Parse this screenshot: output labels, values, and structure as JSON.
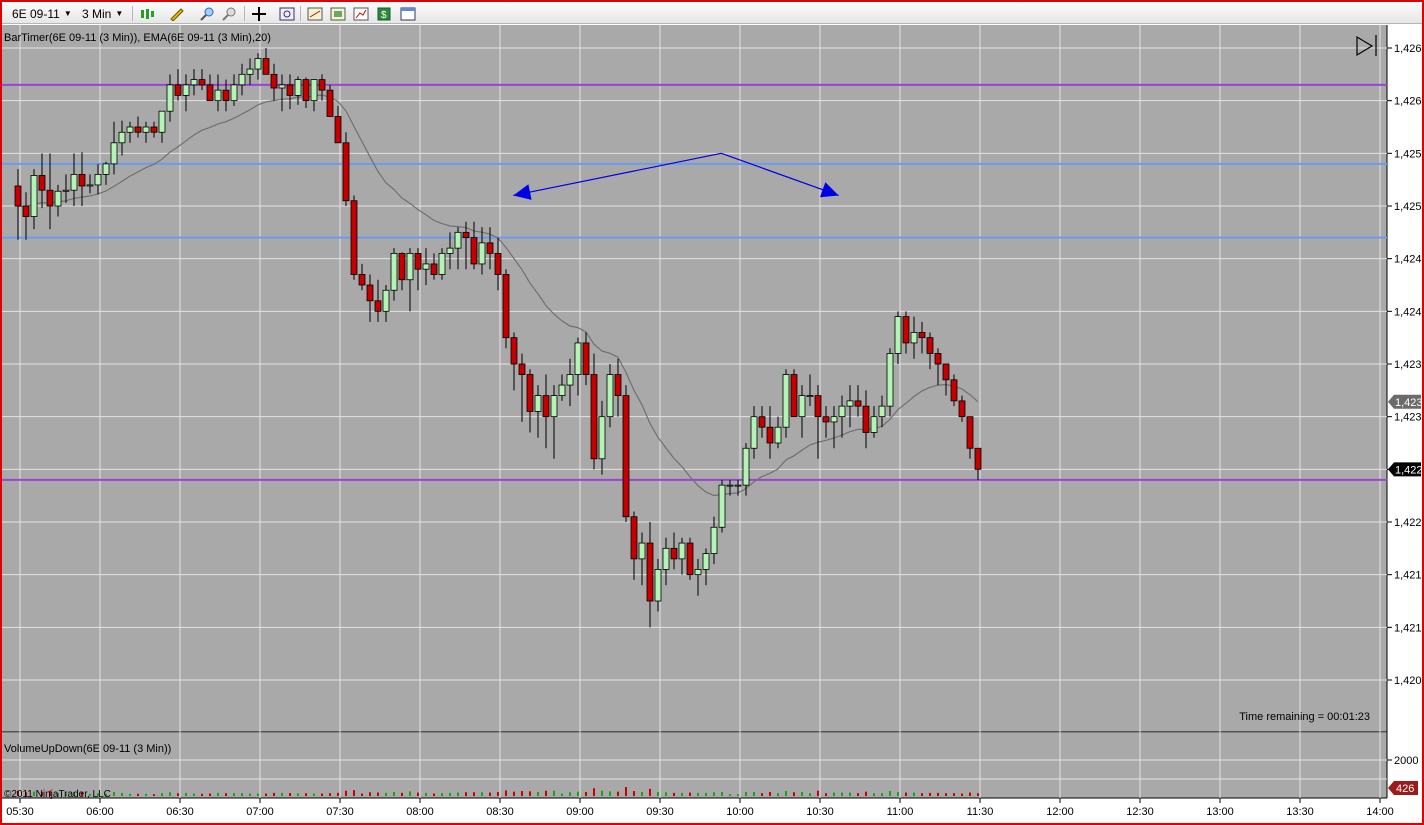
{
  "toolbar": {
    "instrument": "6E 09-11",
    "interval": "3 Min",
    "icons": [
      "candlestick-icon",
      "pencil-draw-icon",
      "zoom-in-icon",
      "zoom-out-icon",
      "crosshair-icon",
      "magnifier-icon",
      "indicators-icon",
      "strategies-icon",
      "chart-properties-icon",
      "data-box-icon",
      "calendar-icon"
    ]
  },
  "price_panel": {
    "label": "BarTimer(6E 09-11 (3 Min)), EMA(6E 09-11 (3 Min),20)",
    "time_remaining": "Time remaining = 00:01:23",
    "price_badges": [
      {
        "label": "1,423",
        "color": "#6b6b6b"
      },
      {
        "label": "1,422",
        "color": "#000000"
      }
    ]
  },
  "volume_panel": {
    "label": "VolumeUpDown(6E 09-11 (3 Min))",
    "axis_label": "2000",
    "current_badge": "426",
    "copyright": "©2011 NinjaTrader, LLC"
  },
  "colors": {
    "background": "#a9a9a9",
    "up_candle": "#b5f2b5",
    "down_candle": "#c40000",
    "ema": "#707070",
    "horizontal_purple": "#9a44d6",
    "horizontal_blue": "#6a9cf2",
    "arrow": "#0000e6",
    "volume_up": "#16a316",
    "volume_down": "#c40000"
  },
  "chart_data": {
    "type": "candlestick",
    "y_tick_labels": [
      "1,426",
      "1,426",
      "1,425",
      "1,425",
      "1,424",
      "1,424",
      "1,423",
      "1,423",
      "1,422",
      "1,422",
      "1,421",
      "1,421",
      "1,420"
    ],
    "y_tick_values": [
      1.4265,
      1.426,
      1.4255,
      1.425,
      1.4245,
      1.424,
      1.4235,
      1.423,
      1.4225,
      1.422,
      1.4215,
      1.421,
      1.4205
    ],
    "x_tick_labels": [
      "05:30",
      "06:00",
      "06:30",
      "07:00",
      "07:30",
      "08:00",
      "08:30",
      "09:00",
      "09:30",
      "10:00",
      "10:30",
      "11:00",
      "11:30",
      "12:00",
      "12:30",
      "13:00",
      "13:30",
      "14:00"
    ],
    "x_start": "05:30",
    "bar_minutes": 3,
    "bars": [
      [
        1.42519,
        1.42535,
        1.42468,
        1.425
      ],
      [
        1.425,
        1.42513,
        1.42468,
        1.4249
      ],
      [
        1.4249,
        1.42535,
        1.42478,
        1.42529
      ],
      [
        1.42529,
        1.4255,
        1.42498,
        1.42515
      ],
      [
        1.42515,
        1.4255,
        1.42478,
        1.425
      ],
      [
        1.425,
        1.4252,
        1.4249,
        1.42514
      ],
      [
        1.42514,
        1.4253,
        1.42503,
        1.42515
      ],
      [
        1.42515,
        1.4255,
        1.425,
        1.4253
      ],
      [
        1.4253,
        1.42551,
        1.425,
        1.42519
      ],
      [
        1.42519,
        1.4253,
        1.42512,
        1.4252
      ],
      [
        1.4252,
        1.4254,
        1.42511,
        1.4253
      ],
      [
        1.4253,
        1.42542,
        1.4252,
        1.4254
      ],
      [
        1.4254,
        1.4258,
        1.4253,
        1.4256
      ],
      [
        1.4256,
        1.42581,
        1.42548,
        1.4257
      ],
      [
        1.4257,
        1.4258,
        1.4256,
        1.42575
      ],
      [
        1.42575,
        1.42585,
        1.42565,
        1.4257
      ],
      [
        1.4257,
        1.4258,
        1.4256,
        1.42575
      ],
      [
        1.42575,
        1.4258,
        1.42565,
        1.4257
      ],
      [
        1.4257,
        1.4259,
        1.4256,
        1.4259
      ],
      [
        1.4259,
        1.42625,
        1.4258,
        1.42615
      ],
      [
        1.42615,
        1.4263,
        1.426,
        1.42605
      ],
      [
        1.42605,
        1.42625,
        1.4259,
        1.42615
      ],
      [
        1.42615,
        1.4263,
        1.42605,
        1.4262
      ],
      [
        1.4262,
        1.4263,
        1.4261,
        1.42615
      ],
      [
        1.42615,
        1.42625,
        1.426,
        1.426
      ],
      [
        1.426,
        1.42625,
        1.4259,
        1.4261
      ],
      [
        1.4261,
        1.4262,
        1.4259,
        1.426
      ],
      [
        1.426,
        1.42625,
        1.42595,
        1.42615
      ],
      [
        1.42615,
        1.42635,
        1.42605,
        1.42625
      ],
      [
        1.42625,
        1.4264,
        1.42615,
        1.4263
      ],
      [
        1.4263,
        1.42645,
        1.4262,
        1.4264
      ],
      [
        1.4264,
        1.4265,
        1.42625,
        1.42625
      ],
      [
        1.42625,
        1.42635,
        1.426,
        1.42612
      ],
      [
        1.42612,
        1.42625,
        1.4259,
        1.42615
      ],
      [
        1.42615,
        1.42625,
        1.42592,
        1.42605
      ],
      [
        1.42605,
        1.42623,
        1.42596,
        1.4262
      ],
      [
        1.4262,
        1.42622,
        1.42593,
        1.426
      ],
      [
        1.426,
        1.42615,
        1.4259,
        1.4262
      ],
      [
        1.4262,
        1.42625,
        1.426,
        1.4261
      ],
      [
        1.4261,
        1.42615,
        1.42585,
        1.42585
      ],
      [
        1.42585,
        1.42595,
        1.4256,
        1.4256
      ],
      [
        1.4256,
        1.4257,
        1.425,
        1.42505
      ],
      [
        1.42505,
        1.4251,
        1.4243,
        1.42435
      ],
      [
        1.42435,
        1.42445,
        1.4242,
        1.42425
      ],
      [
        1.42425,
        1.42435,
        1.4239,
        1.4241
      ],
      [
        1.4241,
        1.4243,
        1.4239,
        1.424
      ],
      [
        1.424,
        1.42425,
        1.4239,
        1.4242
      ],
      [
        1.4242,
        1.4246,
        1.4241,
        1.42455
      ],
      [
        1.42455,
        1.42456,
        1.4242,
        1.4243
      ],
      [
        1.4243,
        1.4246,
        1.424,
        1.42455
      ],
      [
        1.42455,
        1.4246,
        1.4242,
        1.4244
      ],
      [
        1.4244,
        1.4246,
        1.42425,
        1.42445
      ],
      [
        1.42445,
        1.42455,
        1.4243,
        1.42435
      ],
      [
        1.42435,
        1.4246,
        1.4243,
        1.42455
      ],
      [
        1.42455,
        1.42475,
        1.4244,
        1.4246
      ],
      [
        1.4246,
        1.4248,
        1.4244,
        1.42475
      ],
      [
        1.42475,
        1.42485,
        1.4244,
        1.4247
      ],
      [
        1.4247,
        1.42485,
        1.4244,
        1.42445
      ],
      [
        1.42445,
        1.4248,
        1.42435,
        1.42465
      ],
      [
        1.42465,
        1.4248,
        1.4244,
        1.42455
      ],
      [
        1.42455,
        1.4247,
        1.4242,
        1.42435
      ],
      [
        1.42435,
        1.4244,
        1.42365,
        1.42375
      ],
      [
        1.42375,
        1.4238,
        1.42325,
        1.4235
      ],
      [
        1.4235,
        1.4236,
        1.42295,
        1.4234
      ],
      [
        1.4234,
        1.42345,
        1.42285,
        1.42305
      ],
      [
        1.42305,
        1.4233,
        1.4228,
        1.4232
      ],
      [
        1.4232,
        1.4234,
        1.4227,
        1.423
      ],
      [
        1.423,
        1.4233,
        1.4226,
        1.4232
      ],
      [
        1.4232,
        1.4234,
        1.42315,
        1.4233
      ],
      [
        1.4233,
        1.42355,
        1.4231,
        1.4234
      ],
      [
        1.4234,
        1.42375,
        1.4232,
        1.4237
      ],
      [
        1.4237,
        1.4238,
        1.4233,
        1.4234
      ],
      [
        1.4234,
        1.4236,
        1.4225,
        1.4226
      ],
      [
        1.4226,
        1.42315,
        1.42245,
        1.423
      ],
      [
        1.423,
        1.4235,
        1.4229,
        1.4234
      ],
      [
        1.4234,
        1.42355,
        1.423,
        1.4232
      ],
      [
        1.4232,
        1.4233,
        1.422,
        1.42205
      ],
      [
        1.42205,
        1.4221,
        1.42145,
        1.42165
      ],
      [
        1.42165,
        1.4219,
        1.4214,
        1.4218
      ],
      [
        1.4218,
        1.422,
        1.421,
        1.42125
      ],
      [
        1.42125,
        1.42165,
        1.42115,
        1.42155
      ],
      [
        1.42155,
        1.42185,
        1.4214,
        1.42175
      ],
      [
        1.42175,
        1.4219,
        1.42155,
        1.42165
      ],
      [
        1.42165,
        1.42185,
        1.4215,
        1.4218
      ],
      [
        1.4218,
        1.42185,
        1.42145,
        1.4215
      ],
      [
        1.4215,
        1.42165,
        1.4213,
        1.42155
      ],
      [
        1.42155,
        1.42175,
        1.4214,
        1.4217
      ],
      [
        1.4217,
        1.42205,
        1.4216,
        1.42195
      ],
      [
        1.42195,
        1.4224,
        1.4219,
        1.42235
      ],
      [
        1.42235,
        1.4224,
        1.42225,
        1.42235
      ],
      [
        1.42235,
        1.4224,
        1.42225,
        1.42235
      ],
      [
        1.42235,
        1.42275,
        1.42225,
        1.4227
      ],
      [
        1.4227,
        1.4231,
        1.4226,
        1.423
      ],
      [
        1.423,
        1.4231,
        1.4228,
        1.4229
      ],
      [
        1.4229,
        1.4231,
        1.4226,
        1.42275
      ],
      [
        1.42275,
        1.423,
        1.4227,
        1.4229
      ],
      [
        1.4229,
        1.42345,
        1.4228,
        1.4234
      ],
      [
        1.4234,
        1.42345,
        1.423,
        1.423
      ],
      [
        1.423,
        1.4233,
        1.4228,
        1.4232
      ],
      [
        1.4232,
        1.4234,
        1.4231,
        1.4232
      ],
      [
        1.4232,
        1.4233,
        1.4226,
        1.423
      ],
      [
        1.423,
        1.4231,
        1.4228,
        1.42295
      ],
      [
        1.42295,
        1.4231,
        1.4227,
        1.423
      ],
      [
        1.423,
        1.4232,
        1.4228,
        1.4231
      ],
      [
        1.4231,
        1.4233,
        1.4229,
        1.42315
      ],
      [
        1.42315,
        1.4233,
        1.423,
        1.4231
      ],
      [
        1.4231,
        1.42325,
        1.4227,
        1.42285
      ],
      [
        1.42285,
        1.4231,
        1.4228,
        1.423
      ],
      [
        1.423,
        1.4232,
        1.4229,
        1.4231
      ],
      [
        1.4231,
        1.42365,
        1.423,
        1.4236
      ],
      [
        1.4236,
        1.424,
        1.4235,
        1.42395
      ],
      [
        1.42395,
        1.424,
        1.4236,
        1.4237
      ],
      [
        1.4237,
        1.42395,
        1.42355,
        1.4238
      ],
      [
        1.4238,
        1.4239,
        1.4236,
        1.42375
      ],
      [
        1.42375,
        1.4238,
        1.42345,
        1.4236
      ],
      [
        1.4236,
        1.42365,
        1.4233,
        1.4235
      ],
      [
        1.4235,
        1.4235,
        1.4232,
        1.42335
      ],
      [
        1.42335,
        1.4234,
        1.4231,
        1.42315
      ],
      [
        1.42315,
        1.4232,
        1.42295,
        1.423
      ],
      [
        1.423,
        1.423,
        1.4226,
        1.4227
      ],
      [
        1.4227,
        1.4227,
        1.4224,
        1.4225
      ]
    ],
    "ema_period": 20,
    "horizontal_lines": [
      {
        "price": 1.42615,
        "color": "#9a44d6"
      },
      {
        "price": 1.4254,
        "color": "#6a9cf2"
      },
      {
        "price": 1.4247,
        "color": "#6a9cf2"
      },
      {
        "price": 1.4224,
        "color": "#9a44d6"
      }
    ],
    "arrows": [
      {
        "from": [
          "09:53",
          1.4255
        ],
        "to": [
          "08:35",
          1.4251
        ]
      },
      {
        "from": [
          "09:53",
          1.4255
        ],
        "to": [
          "10:37",
          1.4251
        ]
      }
    ],
    "volume": {
      "y_tick_values": [
        2000
      ],
      "y_max": 4000
    }
  }
}
